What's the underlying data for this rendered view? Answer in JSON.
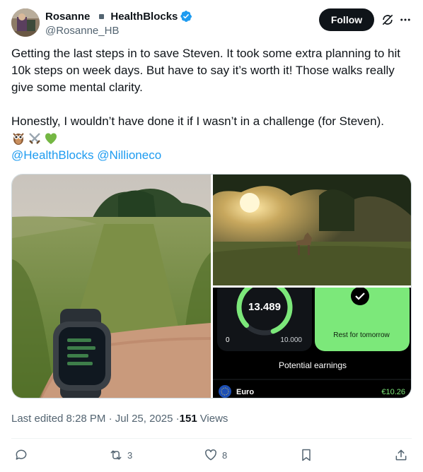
{
  "author": {
    "display_name": "Rosanne",
    "affiliation": "HealthBlocks",
    "handle": "@Rosanne_HB",
    "verified_color": "#1d9bf0"
  },
  "header": {
    "follow_label": "Follow",
    "grok_icon": "grok-icon",
    "more_icon": "more-icon"
  },
  "tweet": {
    "paragraph1": "Getting the last steps in to save Steven. It took some extra planning to hit 10k steps on week days. But have to say it’s worth it! Those walks really give some mental clarity.",
    "paragraph2": "Honestly, I wouldn’t have done it if I wasn’t in a challenge (for Steven).",
    "emojis": [
      "owl",
      "crossed-swords",
      "green-heart"
    ],
    "mention1": "@HealthBlocks",
    "mention2": "@Nillioneco"
  },
  "media": {
    "app": {
      "steps_value": "13.489",
      "range_min": "0",
      "range_max": "10.000",
      "rest_label": "Rest for tomorrow",
      "earnings_label": "Potential earnings",
      "currency_label": "Euro",
      "currency_amount": "€10.26",
      "ring_fraction": 0.82
    }
  },
  "meta": {
    "edited": "Last edited 8:28 PM · Jul 25, 2025 · ",
    "views_count": "151",
    "views_label": "Views"
  },
  "actions": {
    "reply_count": "",
    "retweet_count": "3",
    "like_count": "8"
  },
  "colors": {
    "accent": "#1d9bf0",
    "text": "#0f1419",
    "muted": "#536471",
    "app_green": "#7ce87a"
  }
}
